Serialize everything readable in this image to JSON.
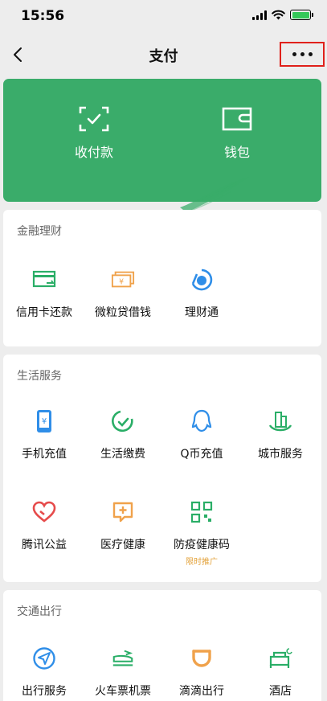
{
  "status_bar": {
    "time": "15:56"
  },
  "nav": {
    "title": "支付"
  },
  "banner": {
    "pay_label": "收付款",
    "wallet_label": "钱包"
  },
  "sections": {
    "finance": {
      "title": "金融理财",
      "items": [
        {
          "label": "信用卡还款",
          "icon": "credit-card-icon"
        },
        {
          "label": "微粒贷借钱",
          "icon": "cash-icon"
        },
        {
          "label": "理财通",
          "icon": "wealth-icon"
        }
      ]
    },
    "life": {
      "title": "生活服务",
      "items": [
        {
          "label": "手机充值",
          "icon": "phone-icon"
        },
        {
          "label": "生活缴费",
          "icon": "utility-icon"
        },
        {
          "label": "Q币充值",
          "icon": "qq-icon"
        },
        {
          "label": "城市服务",
          "icon": "city-icon"
        },
        {
          "label": "腾讯公益",
          "icon": "charity-heart-icon"
        },
        {
          "label": "医疗健康",
          "icon": "medical-icon"
        },
        {
          "label": "防疫健康码",
          "icon": "qr-code-icon",
          "badge": "限时推广"
        }
      ]
    },
    "transport": {
      "title": "交通出行",
      "items": [
        {
          "label": "出行服务",
          "icon": "navigation-icon"
        },
        {
          "label": "火车票机票",
          "icon": "train-icon"
        },
        {
          "label": "滴滴出行",
          "icon": "didi-icon"
        },
        {
          "label": "酒店",
          "icon": "hotel-icon"
        }
      ]
    }
  },
  "colors": {
    "brand_green": "#3aac6a",
    "icon_green": "#2aae67",
    "icon_orange": "#f0a24b",
    "icon_blue": "#2f8ee8",
    "icon_red": "#e64b4b",
    "highlight_red": "#e0211b"
  }
}
